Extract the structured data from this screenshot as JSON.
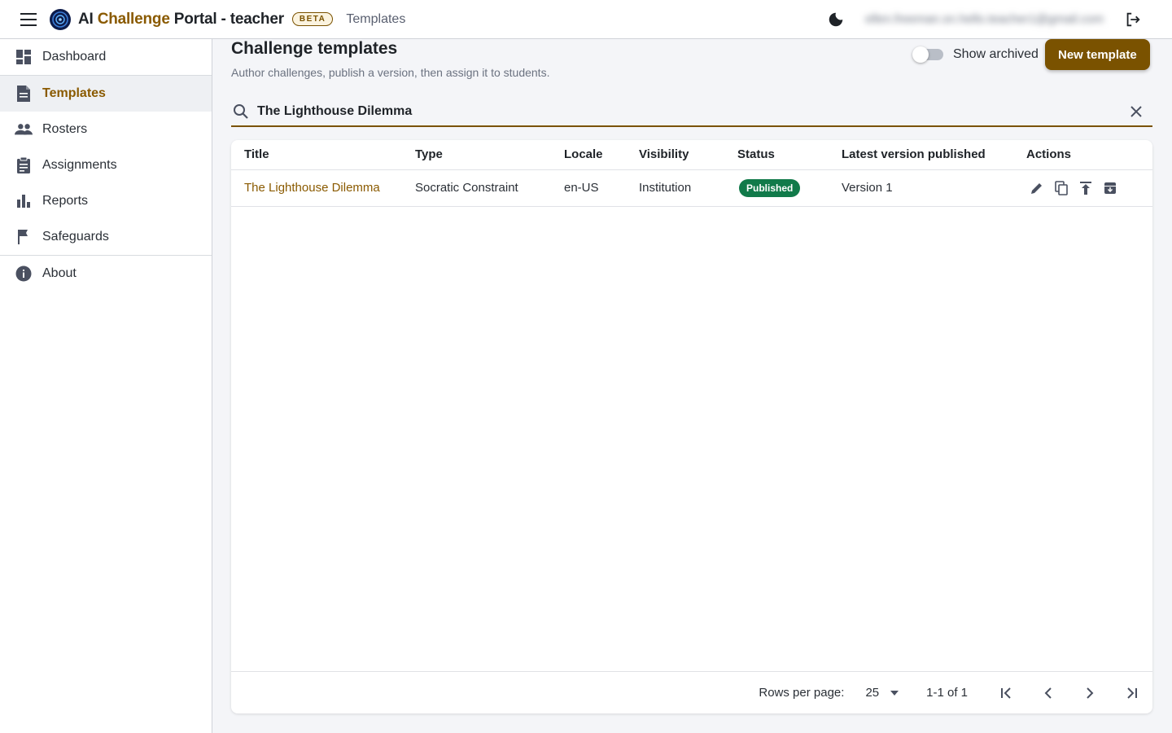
{
  "header": {
    "title_prefix": "AI ",
    "title_accent": "Challenge",
    "title_suffix": " Portal - teacher",
    "beta_label": "BETA",
    "breadcrumb": "Templates",
    "user_email": "ellen.freeman.sn.hello.teacher1@gmail.com"
  },
  "sidebar": {
    "items": [
      {
        "label": "Dashboard",
        "icon": "dashboard-icon"
      },
      {
        "label": "Templates",
        "icon": "document-icon"
      },
      {
        "label": "Rosters",
        "icon": "people-icon"
      },
      {
        "label": "Assignments",
        "icon": "clipboard-icon"
      },
      {
        "label": "Reports",
        "icon": "bar-chart-icon"
      },
      {
        "label": "Safeguards",
        "icon": "flag-icon"
      },
      {
        "label": "About",
        "icon": "info-icon"
      }
    ]
  },
  "main": {
    "title": "Challenge templates",
    "subtitle": "Author challenges, publish a version, then assign it to students.",
    "show_archived_label": "Show archived",
    "new_template_label": "New template",
    "search": {
      "value": "The Lighthouse Dilemma",
      "placeholder": "Search templates"
    },
    "table": {
      "headers": [
        "Title",
        "Type",
        "Locale",
        "Visibility",
        "Status",
        "Latest version published",
        "Actions"
      ],
      "rows": [
        {
          "title": "The Lighthouse Dilemma",
          "type": "Socratic Constraint",
          "locale": "en-US",
          "visibility": "Institution",
          "status": "Published",
          "latest": "Version 1"
        }
      ]
    },
    "footer": {
      "rows_per_page_label": "Rows per page:",
      "rows_per_page_value": "25",
      "range": "1-1 of 1"
    }
  },
  "colors": {
    "accent": "#7a5200",
    "status_published": "#117a4a"
  }
}
